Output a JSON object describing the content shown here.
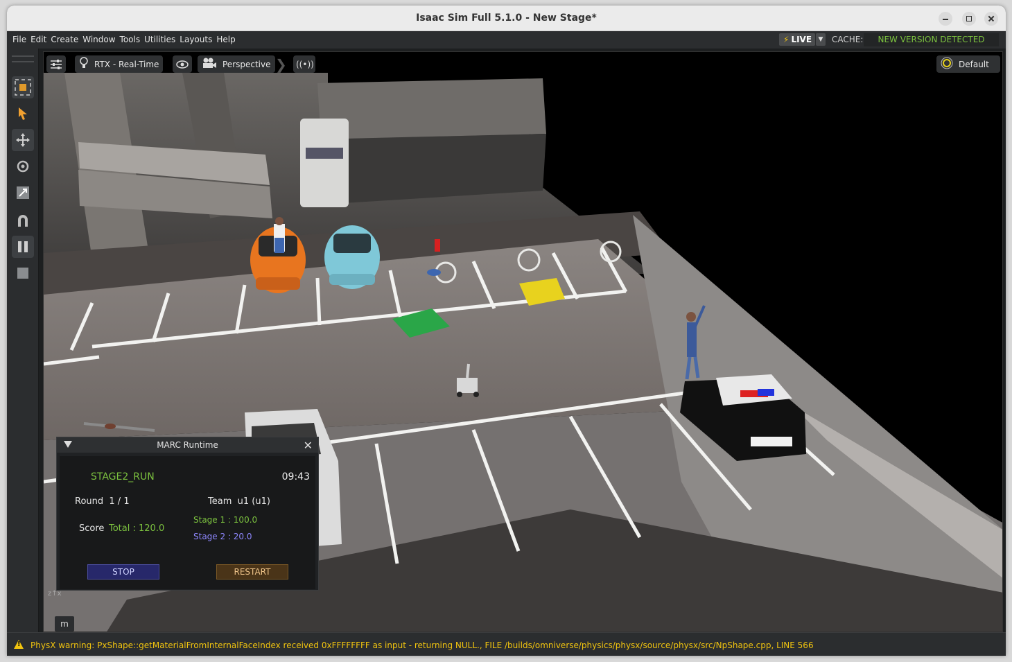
{
  "window": {
    "title": "Isaac Sim Full 5.1.0 - New Stage*"
  },
  "menu": [
    "File",
    "Edit",
    "Create",
    "Window",
    "Tools",
    "Utilities",
    "Layouts",
    "Help"
  ],
  "menubar_right": {
    "live": "LIVE",
    "cache_label": "CACHE:",
    "cache_status": "NEW VERSION DETECTED"
  },
  "viewport": {
    "render_mode": "RTX - Real-Time",
    "camera": "Perspective",
    "lighting": "Default",
    "overlay_key": "m"
  },
  "marc": {
    "title": "MARC Runtime",
    "state": "STAGE2_RUN",
    "timer": "09:43",
    "round_label": "Round",
    "round_value": "1 / 1",
    "team_label": "Team",
    "team_value": "u1 (u1)",
    "score_label": "Score",
    "total": "Total : 120.0",
    "stage1": "Stage 1 : 100.0",
    "stage2": "Stage 2 : 20.0",
    "stop": "STOP",
    "restart": "RESTART"
  },
  "status": {
    "message": "PhysX warning: PxShape::getMaterialFromInternalFaceIndex received 0xFFFFFFFF as input - returning NULL., FILE /builds/omniverse/physics/physx/source/physx/src/NpShape.cpp, LINE 566"
  },
  "colors": {
    "accent_green": "#7cc23f",
    "stage2_purple": "#8f88ff",
    "warning_yellow": "#f1c40f"
  }
}
